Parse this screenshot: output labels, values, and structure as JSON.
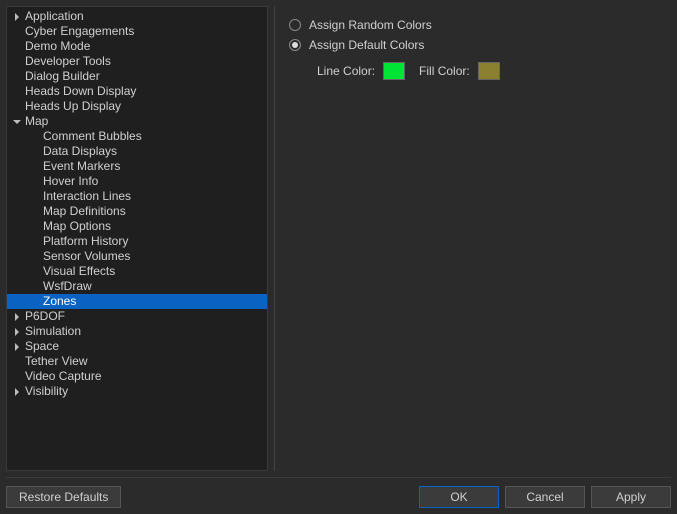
{
  "tree": {
    "items": [
      {
        "label": "Application",
        "level": 0,
        "arrow": "right",
        "selected": false
      },
      {
        "label": "Cyber Engagements",
        "level": 0,
        "arrow": "none",
        "selected": false
      },
      {
        "label": "Demo Mode",
        "level": 0,
        "arrow": "none",
        "selected": false
      },
      {
        "label": "Developer Tools",
        "level": 0,
        "arrow": "none",
        "selected": false
      },
      {
        "label": "Dialog Builder",
        "level": 0,
        "arrow": "none",
        "selected": false
      },
      {
        "label": "Heads Down Display",
        "level": 0,
        "arrow": "none",
        "selected": false
      },
      {
        "label": "Heads Up Display",
        "level": 0,
        "arrow": "none",
        "selected": false
      },
      {
        "label": "Map",
        "level": 0,
        "arrow": "down",
        "selected": false
      },
      {
        "label": "Comment Bubbles",
        "level": 1,
        "arrow": "none",
        "selected": false
      },
      {
        "label": "Data Displays",
        "level": 1,
        "arrow": "none",
        "selected": false
      },
      {
        "label": "Event Markers",
        "level": 1,
        "arrow": "none",
        "selected": false
      },
      {
        "label": "Hover Info",
        "level": 1,
        "arrow": "none",
        "selected": false
      },
      {
        "label": "Interaction Lines",
        "level": 1,
        "arrow": "none",
        "selected": false
      },
      {
        "label": "Map Definitions",
        "level": 1,
        "arrow": "none",
        "selected": false
      },
      {
        "label": "Map Options",
        "level": 1,
        "arrow": "none",
        "selected": false
      },
      {
        "label": "Platform History",
        "level": 1,
        "arrow": "none",
        "selected": false
      },
      {
        "label": "Sensor Volumes",
        "level": 1,
        "arrow": "none",
        "selected": false
      },
      {
        "label": "Visual Effects",
        "level": 1,
        "arrow": "none",
        "selected": false
      },
      {
        "label": "WsfDraw",
        "level": 1,
        "arrow": "none",
        "selected": false
      },
      {
        "label": "Zones",
        "level": 1,
        "arrow": "none",
        "selected": true
      },
      {
        "label": "P6DOF",
        "level": 0,
        "arrow": "right",
        "selected": false
      },
      {
        "label": "Simulation",
        "level": 0,
        "arrow": "right",
        "selected": false
      },
      {
        "label": "Space",
        "level": 0,
        "arrow": "right",
        "selected": false
      },
      {
        "label": "Tether View",
        "level": 0,
        "arrow": "none",
        "selected": false
      },
      {
        "label": "Video Capture",
        "level": 0,
        "arrow": "none",
        "selected": false
      },
      {
        "label": "Visibility",
        "level": 0,
        "arrow": "right",
        "selected": false
      }
    ]
  },
  "panel": {
    "radio_random": {
      "label": "Assign Random Colors",
      "checked": false
    },
    "radio_default": {
      "label": "Assign Default Colors",
      "checked": true
    },
    "line_color_label": "Line Color:",
    "fill_color_label": "Fill Color:",
    "line_color": "#00e436",
    "fill_color": "#8a8030"
  },
  "footer": {
    "restore": "Restore Defaults",
    "ok": "OK",
    "cancel": "Cancel",
    "apply": "Apply"
  }
}
